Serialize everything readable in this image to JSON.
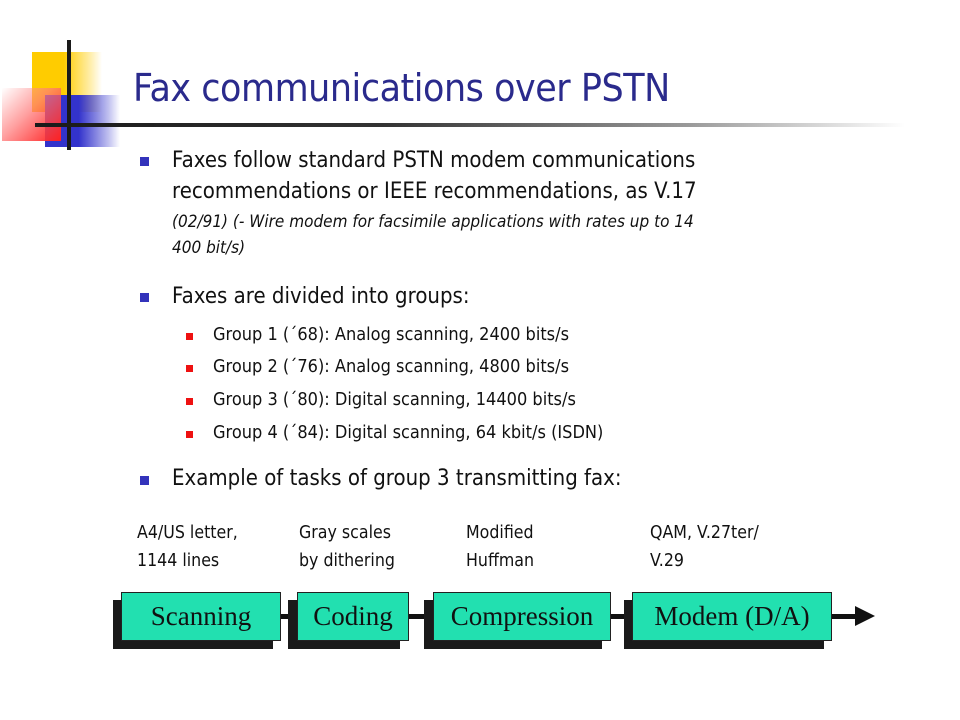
{
  "slide": {
    "title": "Fax communications over PSTN",
    "bullets": [
      {
        "line1": "Faxes follow standard PSTN modem communications",
        "line2": "recommendations or IEEE recommendations, as V.17",
        "note_line1": "(02/91) (- Wire modem for facsimile applications with rates up to 14",
        "note_line2": "400 bit/s)"
      },
      {
        "text": "Faxes are divided into groups:",
        "subitems": [
          "Group 1 (´68): Analog scanning, 2400 bits/s",
          "Group 2 (´76): Analog scanning, 4800 bits/s",
          "Group 3 (´80): Digital scanning, 14400 bits/s",
          "Group 4 (´84): Digital scanning, 64 kbit/s (ISDN)"
        ]
      },
      {
        "text": "Example of tasks of group 3 transmitting fax:"
      }
    ],
    "colors": {
      "title": "#2a2a8c",
      "bullet_level1": "#3333bb",
      "bullet_level2": "#ee1111",
      "stage_box": "#22e0b0"
    }
  },
  "pipeline": {
    "stages": [
      {
        "label": "Scanning",
        "note_line1": "A4/US letter,",
        "note_line2": "1144 lines"
      },
      {
        "label": "Coding",
        "note_line1": "Gray scales",
        "note_line2": "by dithering"
      },
      {
        "label": "Compression",
        "note_line1": "Modified",
        "note_line2": "Huffman"
      },
      {
        "label": "Modem (D/A)",
        "note_line1": "QAM, V.27ter/",
        "note_line2": "V.29"
      }
    ],
    "output_arrow": "arrow-right"
  }
}
